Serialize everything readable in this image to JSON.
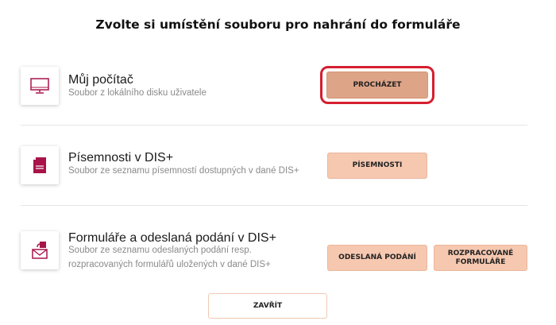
{
  "dialog": {
    "title": "Zvolte si umístění souboru pro nahrání do formuláře",
    "close_label": "ZAVŘÍT"
  },
  "options": [
    {
      "icon": "monitor-icon",
      "title": "Můj počítač",
      "description": "Soubor z lokálního disku uživatele",
      "buttons": [
        "PROCHÁZET"
      ]
    },
    {
      "icon": "document-icon",
      "title": "Písemnosti v DIS+",
      "description": "Soubor ze seznamu písemností dostupných v dané DIS+",
      "buttons": [
        "PÍSEMNOSTI"
      ]
    },
    {
      "icon": "inbox-upload-icon",
      "title": "Formuláře a odeslaná podání v DIS+",
      "description_lines": [
        "Soubor ze seznamu odeslaných podání resp.",
        "rozpracovaných formulářů uložených v dané DIS+"
      ],
      "buttons": [
        "ODESLANÁ PODÁNÍ",
        "ROZPRACOVANÉ",
        "FORMULÁŘE"
      ]
    }
  ],
  "colors": {
    "accent": "#a8144a",
    "button": "#f6c8b0",
    "button_active": "#dea488",
    "highlight": "#d51f2f"
  }
}
